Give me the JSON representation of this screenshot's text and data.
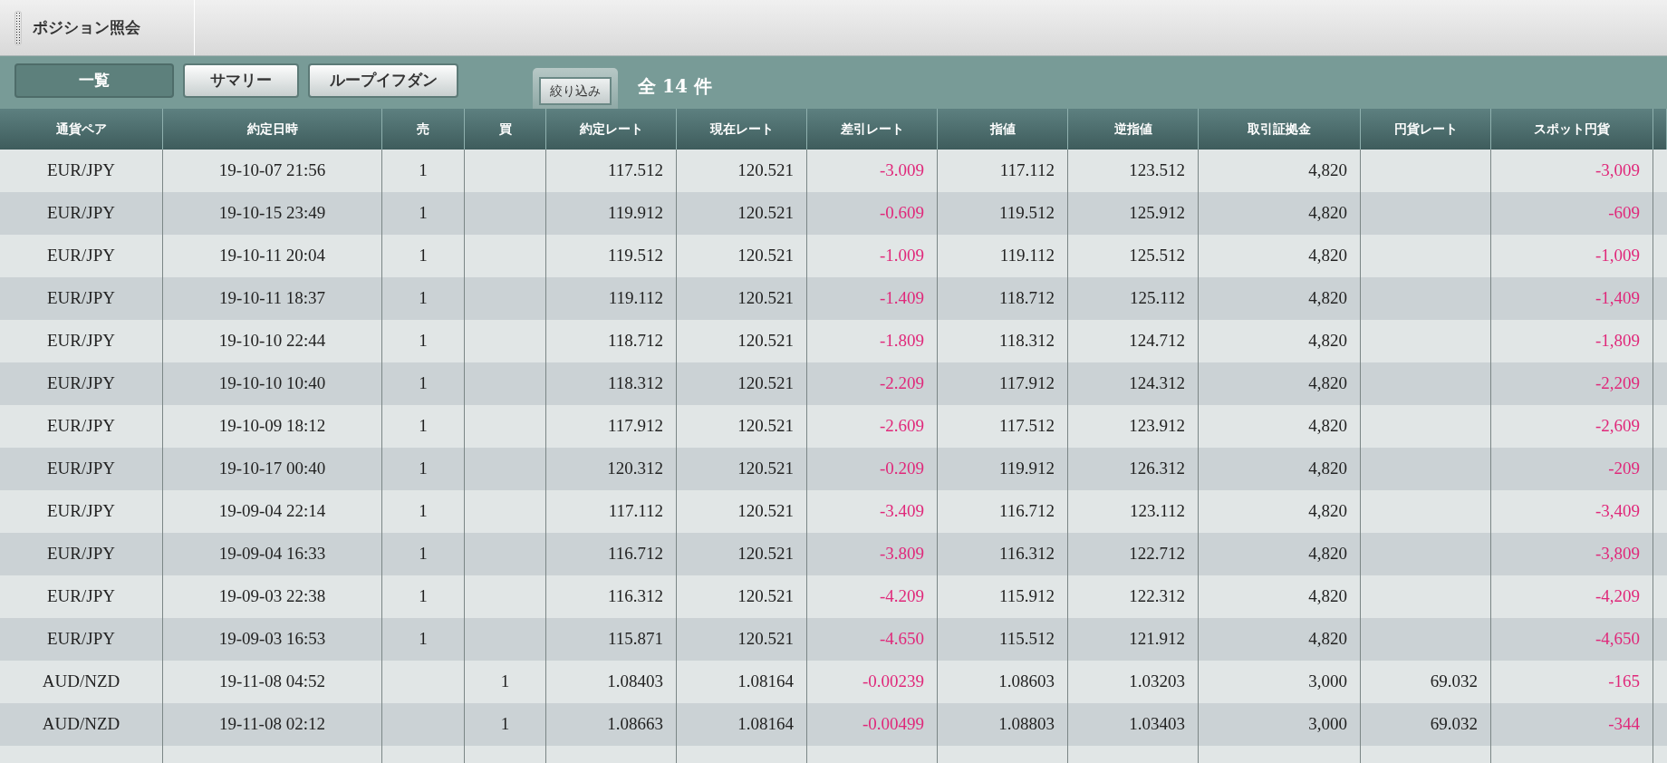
{
  "window": {
    "title": "ポジション照会"
  },
  "tabs": [
    {
      "label": "一覧",
      "selected": true
    },
    {
      "label": "サマリー",
      "selected": false
    },
    {
      "label": "ループイフダン",
      "selected": false
    }
  ],
  "filter_button": {
    "label": "絞り込み"
  },
  "count": "全 14 件",
  "table": {
    "columns": [
      {
        "label": "通貨ペア",
        "kind": "center"
      },
      {
        "label": "約定日時",
        "kind": "center"
      },
      {
        "label": "売",
        "kind": "center"
      },
      {
        "label": "買",
        "kind": "center"
      },
      {
        "label": "約定レート",
        "kind": "right"
      },
      {
        "label": "現在レート",
        "kind": "right"
      },
      {
        "label": "差引レート",
        "kind": "signed"
      },
      {
        "label": "指値",
        "kind": "right"
      },
      {
        "label": "逆指値",
        "kind": "right"
      },
      {
        "label": "取引証拠金",
        "kind": "right"
      },
      {
        "label": "円貨レート",
        "kind": "right"
      },
      {
        "label": "スポット円貨",
        "kind": "signed"
      }
    ],
    "rows": [
      [
        "EUR/JPY",
        "19-10-07 21:56",
        "1",
        "",
        "117.512",
        "120.521",
        "-3.009",
        "117.112",
        "123.512",
        "4,820",
        "",
        "-3,009"
      ],
      [
        "EUR/JPY",
        "19-10-15 23:49",
        "1",
        "",
        "119.912",
        "120.521",
        "-0.609",
        "119.512",
        "125.912",
        "4,820",
        "",
        "-609"
      ],
      [
        "EUR/JPY",
        "19-10-11 20:04",
        "1",
        "",
        "119.512",
        "120.521",
        "-1.009",
        "119.112",
        "125.512",
        "4,820",
        "",
        "-1,009"
      ],
      [
        "EUR/JPY",
        "19-10-11 18:37",
        "1",
        "",
        "119.112",
        "120.521",
        "-1.409",
        "118.712",
        "125.112",
        "4,820",
        "",
        "-1,409"
      ],
      [
        "EUR/JPY",
        "19-10-10 22:44",
        "1",
        "",
        "118.712",
        "120.521",
        "-1.809",
        "118.312",
        "124.712",
        "4,820",
        "",
        "-1,809"
      ],
      [
        "EUR/JPY",
        "19-10-10 10:40",
        "1",
        "",
        "118.312",
        "120.521",
        "-2.209",
        "117.912",
        "124.312",
        "4,820",
        "",
        "-2,209"
      ],
      [
        "EUR/JPY",
        "19-10-09 18:12",
        "1",
        "",
        "117.912",
        "120.521",
        "-2.609",
        "117.512",
        "123.912",
        "4,820",
        "",
        "-2,609"
      ],
      [
        "EUR/JPY",
        "19-10-17 00:40",
        "1",
        "",
        "120.312",
        "120.521",
        "-0.209",
        "119.912",
        "126.312",
        "4,820",
        "",
        "-209"
      ],
      [
        "EUR/JPY",
        "19-09-04 22:14",
        "1",
        "",
        "117.112",
        "120.521",
        "-3.409",
        "116.712",
        "123.112",
        "4,820",
        "",
        "-3,409"
      ],
      [
        "EUR/JPY",
        "19-09-04 16:33",
        "1",
        "",
        "116.712",
        "120.521",
        "-3.809",
        "116.312",
        "122.712",
        "4,820",
        "",
        "-3,809"
      ],
      [
        "EUR/JPY",
        "19-09-03 22:38",
        "1",
        "",
        "116.312",
        "120.521",
        "-4.209",
        "115.912",
        "122.312",
        "4,820",
        "",
        "-4,209"
      ],
      [
        "EUR/JPY",
        "19-09-03 16:53",
        "1",
        "",
        "115.871",
        "120.521",
        "-4.650",
        "115.512",
        "121.912",
        "4,820",
        "",
        "-4,650"
      ],
      [
        "AUD/NZD",
        "19-11-08 04:52",
        "",
        "1",
        "1.08403",
        "1.08164",
        "-0.00239",
        "1.08603",
        "1.03203",
        "3,000",
        "69.032",
        "-165"
      ],
      [
        "AUD/NZD",
        "19-11-08 02:12",
        "",
        "1",
        "1.08663",
        "1.08164",
        "-0.00499",
        "1.08803",
        "1.03403",
        "3,000",
        "69.032",
        "-344"
      ]
    ]
  }
}
